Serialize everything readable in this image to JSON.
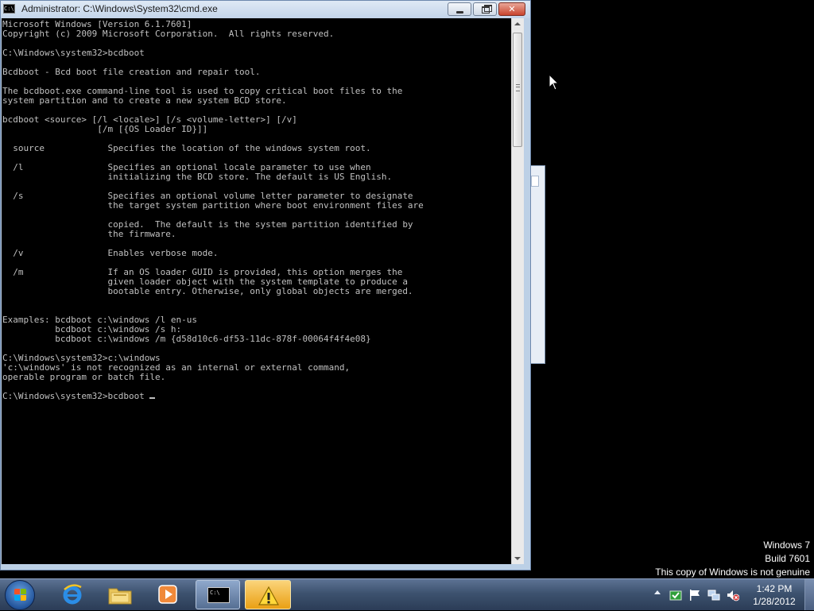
{
  "window": {
    "title": "Administrator: C:\\Windows\\System32\\cmd.exe",
    "icon_label": "C:\\",
    "minimize_icon": "minimize-icon",
    "maximize_icon": "restore-icon",
    "close_glyph": "✕"
  },
  "console": {
    "lines": [
      "Microsoft Windows [Version 6.1.7601]",
      "Copyright (c) 2009 Microsoft Corporation.  All rights reserved.",
      "",
      "C:\\Windows\\system32>bcdboot",
      "",
      "Bcdboot - Bcd boot file creation and repair tool.",
      "",
      "The bcdboot.exe command-line tool is used to copy critical boot files to the",
      "system partition and to create a new system BCD store.",
      "",
      "bcdboot <source> [/l <locale>] [/s <volume-letter>] [/v]",
      "                  [/m [{OS Loader ID}]]",
      "",
      "  source            Specifies the location of the windows system root.",
      "",
      "  /l                Specifies an optional locale parameter to use when",
      "                    initializing the BCD store. The default is US English.",
      "",
      "  /s                Specifies an optional volume letter parameter to designate",
      "                    the target system partition where boot environment files are",
      "",
      "                    copied.  The default is the system partition identified by",
      "                    the firmware.",
      "",
      "  /v                Enables verbose mode.",
      "",
      "  /m                If an OS loader GUID is provided, this option merges the",
      "                    given loader object with the system template to produce a",
      "                    bootable entry. Otherwise, only global objects are merged.",
      "",
      "",
      "Examples: bcdboot c:\\windows /l en-us",
      "          bcdboot c:\\windows /s h:",
      "          bcdboot c:\\windows /m {d58d10c6-df53-11dc-878f-00064f4f4e08}",
      "",
      "C:\\Windows\\system32>c:\\windows",
      "'c:\\windows' is not recognized as an internal or external command,",
      "operable program or batch file.",
      "",
      "C:\\Windows\\system32>bcdboot "
    ],
    "text_color": "#c0c0c0",
    "background": "#000000"
  },
  "watermark": {
    "line1": "Windows 7",
    "line2": "Build 7601",
    "line3": "This copy of Windows is not genuine"
  },
  "taskbar": {
    "buttons": [
      {
        "name": "start",
        "icon": "windows-logo-icon"
      },
      {
        "name": "internet-explorer",
        "icon": "internet-explorer-icon"
      },
      {
        "name": "windows-explorer",
        "icon": "folder-icon"
      },
      {
        "name": "media-player",
        "icon": "media-player-icon"
      },
      {
        "name": "command-prompt",
        "icon": "cmd-icon",
        "label": "C:\\"
      },
      {
        "name": "action-center-warning",
        "icon": "warning-icon"
      }
    ],
    "tray": {
      "icons": [
        "show-hidden-icons-icon",
        "action-center-icon",
        "flag-icon",
        "network-icon",
        "volume-muted-icon"
      ],
      "time": "1:42 PM",
      "date": "1/28/2012"
    }
  },
  "colors": {
    "accent": "#3d526f",
    "close_button": "#c9442d",
    "warning": "#e9a014"
  }
}
